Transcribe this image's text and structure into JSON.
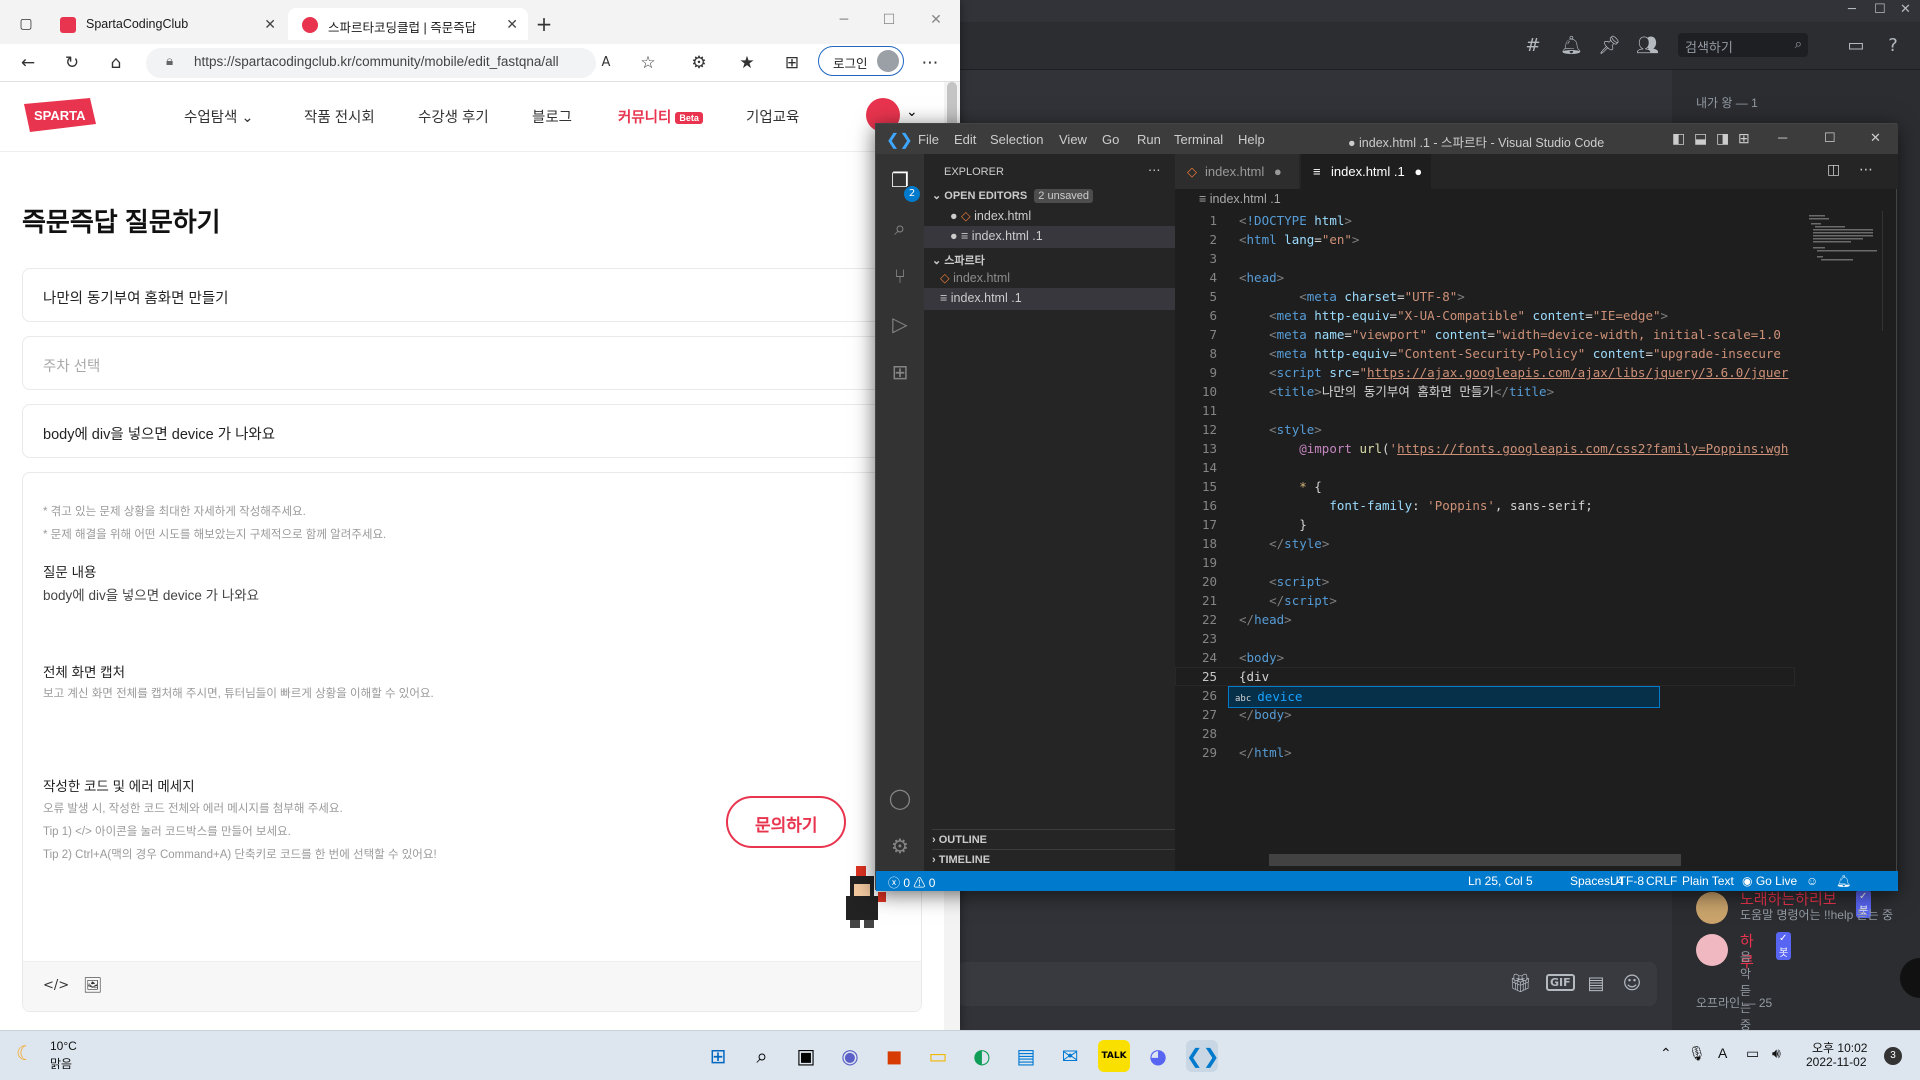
{
  "discord": {
    "search_placeholder": "검색하기",
    "member_header_top": "내가 왕 — 1",
    "members": [
      {
        "name": "노래하는하리보",
        "status": "도움말 명령어는 !!help 듣는 중",
        "badge": "✓봇"
      },
      {
        "name": "하루",
        "status": "음악 듣는 중",
        "badge": "✓봇"
      }
    ],
    "offline_header": "오프라인 — 25"
  },
  "edge": {
    "tabs": [
      {
        "label": "SpartaCodingClub",
        "active": false
      },
      {
        "label": "스파르타코딩클럽 | 즉문즉답",
        "active": true
      }
    ],
    "new_tab": "+",
    "url": "https://spartacodingclub.kr/community/mobile/edit_fastqna/all",
    "login_label": "로그인"
  },
  "sparta": {
    "logo_text": "SPARTA",
    "nav": [
      "수업탐색",
      "작품 전시회",
      "수강생 후기",
      "블로그",
      "커뮤니티",
      "기업교육"
    ],
    "beta_badge": "Beta",
    "title": "즉문즉답 질문하기",
    "question_title": "나만의 동기부여 홈화면 만들기",
    "week_placeholder": "주차 선택",
    "summary": "body에 div을 넣으면 device 가 나와요",
    "hints": [
      "* 겪고 있는 문제 상황을 최대한 자세하게 작성해주세요.",
      "* 문제 해결을 위해 어떤 시도를 해보았는지 구체적으로 함께 알려주세요."
    ],
    "section1_title": "질문 내용",
    "section1_body": "body에 div을 넣으면 device 가 나와요",
    "section2_title": "전체 화면 캡처",
    "section2_hint": "보고 계신 화면 전체를 캡처해 주시면, 튜터님들이 빠르게 상황을 이해할 수 있어요.",
    "section3_title": "작성한 코드 및 에러 메세지",
    "section3_hints": [
      "오류 발생 시, 작성한 코드 전체와 에러 메시지를 첨부해 주세요.",
      "Tip 1) </> 아이콘을 눌러 코드박스를 만들어 보세요.",
      "Tip 2) Ctrl+A(맥의 경우 Command+A) 단축키로 코드를 한 번에 선택할 수 있어요!"
    ],
    "ask_button": "문의하기"
  },
  "vscode": {
    "title": "● index.html .1 - 스파르타 - Visual Studio Code",
    "menu": [
      "File",
      "Edit",
      "Selection",
      "View",
      "Go",
      "Run",
      "Terminal",
      "Help"
    ],
    "explorer_label": "EXPLORER",
    "open_editors_label": "OPEN EDITORS",
    "unsaved_badge": "2 unsaved",
    "open_editors": [
      "index.html",
      "index.html .1"
    ],
    "folder_name": "스파르타",
    "folder_files": [
      "index.html",
      "index.html .1"
    ],
    "outline_label": "OUTLINE",
    "timeline_label": "TIMELINE",
    "explorer_badge": "2",
    "tabs": [
      "index.html",
      "index.html .1"
    ],
    "breadcrumb": "index.html .1",
    "suggestion": "device",
    "status": {
      "errors": "0",
      "warnings": "0",
      "position": "Ln 25, Col 5",
      "spaces": "Spaces: 4",
      "encoding": "UTF-8",
      "eol": "CRLF",
      "language": "Plain Text",
      "golive": "Go Live"
    }
  },
  "taskbar": {
    "weather_temp": "10°C",
    "weather_desc": "맑음",
    "time": "오후 10:02",
    "date": "2022-11-02",
    "notif_count": "3"
  },
  "colors": {
    "sparta_red": "#e8344e",
    "vscode_blue": "#007acc",
    "discord_bg": "#313338"
  }
}
